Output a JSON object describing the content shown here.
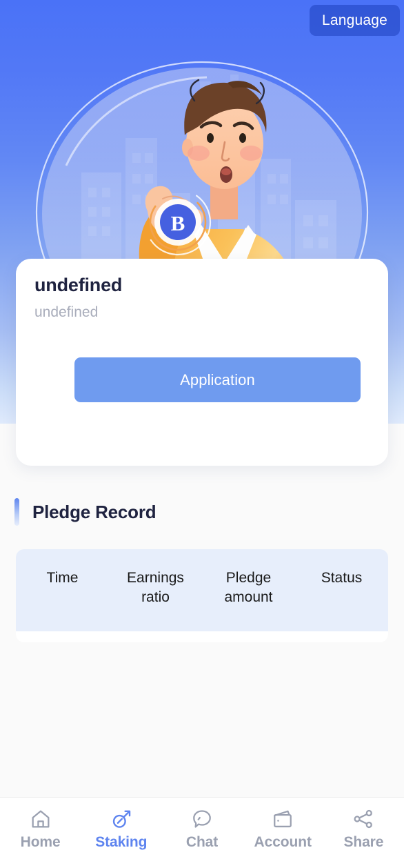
{
  "header": {
    "language_button": "Language"
  },
  "hero": {
    "illustration_name": "crypto-investor-illustration",
    "description": "Man in orange sweater holding a Bitcoin coin with dollar and bitcoin exchange arrows",
    "colors": {
      "gradient_top": "#4a72f7",
      "gradient_bottom": "#dfeafc",
      "coin_blue": "#4560e0",
      "sweater_orange": "#f7a93e",
      "hair_brown": "#6b4128",
      "skin": "#fcc8a6"
    }
  },
  "card": {
    "title": "undefined",
    "subtitle": "undefined",
    "apply_button": "Application",
    "button_color": "#6f9bef"
  },
  "pledge_record": {
    "title": "Pledge Record",
    "accent_color": "#5f86ef",
    "table": {
      "header_background": "#e7eefb",
      "columns": [
        "Time",
        "Earnings ratio",
        "Pledge amount",
        "Status"
      ],
      "rows": []
    }
  },
  "tabbar": {
    "active_color": "#5e84ef",
    "inactive_color": "#9aa0b0",
    "items": [
      {
        "label": "Home",
        "icon": "home-icon",
        "active": false
      },
      {
        "label": "Staking",
        "icon": "pickaxe-icon",
        "active": true
      },
      {
        "label": "Chat",
        "icon": "chat-bubble-icon",
        "active": false
      },
      {
        "label": "Account",
        "icon": "wallet-icon",
        "active": false
      },
      {
        "label": "Share",
        "icon": "share-nodes-icon",
        "active": false
      }
    ]
  }
}
